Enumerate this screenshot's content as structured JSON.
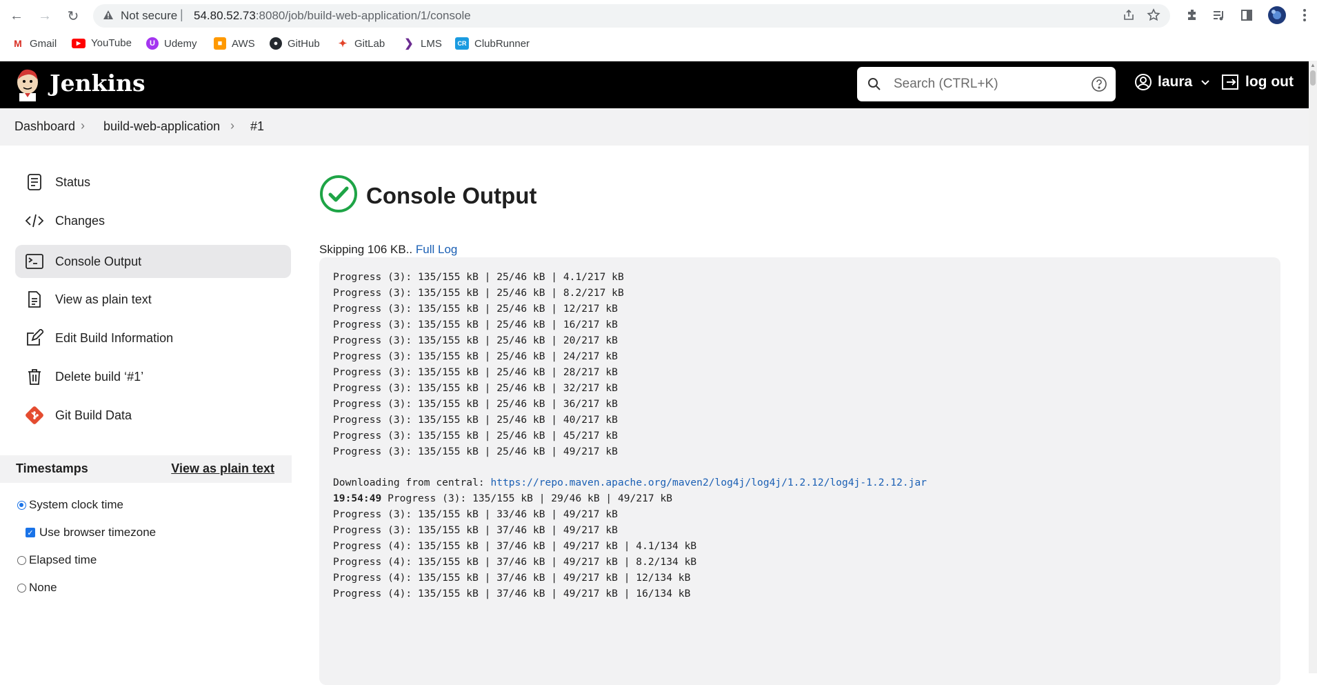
{
  "browser": {
    "security_label": "Not secure",
    "url_host": "54.80.52.73",
    "url_port_path": ":8080/job/build-web-application/1/console",
    "bookmarks": [
      "Gmail",
      "YouTube",
      "Udemy",
      "AWS",
      "GitHub",
      "GitLab",
      "LMS",
      "ClubRunner"
    ]
  },
  "header": {
    "title": "Jenkins",
    "search_placeholder": "Search (CTRL+K)",
    "user": "laura",
    "logout": "log out"
  },
  "breadcrumb": [
    "Dashboard",
    "build-web-application",
    "#1"
  ],
  "sidebar": {
    "tasks": [
      "Status",
      "Changes",
      "Console Output",
      "View as plain text",
      "Edit Build Information",
      "Delete build ‘#1’",
      "Git Build Data"
    ],
    "active_task": "Console Output",
    "timestamps_title": "Timestamps",
    "timestamps_link": "View as plain text",
    "options": {
      "system_clock": "System clock time",
      "browser_tz": "Use browser timezone",
      "elapsed": "Elapsed time",
      "none": "None"
    }
  },
  "main": {
    "title": "Console Output",
    "skipping": "Skipping 106 KB..",
    "full_log": "Full Log",
    "log_lines": [
      "Progress (3): 135/155 kB | 25/46 kB | 4.1/217 kB",
      "Progress (3): 135/155 kB | 25/46 kB | 8.2/217 kB",
      "Progress (3): 135/155 kB | 25/46 kB | 12/217 kB",
      "Progress (3): 135/155 kB | 25/46 kB | 16/217 kB",
      "Progress (3): 135/155 kB | 25/46 kB | 20/217 kB",
      "Progress (3): 135/155 kB | 25/46 kB | 24/217 kB",
      "Progress (3): 135/155 kB | 25/46 kB | 28/217 kB",
      "Progress (3): 135/155 kB | 25/46 kB | 32/217 kB",
      "Progress (3): 135/155 kB | 25/46 kB | 36/217 kB",
      "Progress (3): 135/155 kB | 25/46 kB | 40/217 kB",
      "Progress (3): 135/155 kB | 25/46 kB | 45/217 kB",
      "Progress (3): 135/155 kB | 25/46 kB | 49/217 kB"
    ],
    "download_prefix": "Downloading from central: ",
    "download_url": "https://repo.maven.apache.org/maven2/log4j/log4j/1.2.12/log4j-1.2.12.jar",
    "timestamp": "19:54:49",
    "timestamp_line": " Progress (3): 135/155 kB | 29/46 kB | 49/217 kB",
    "log_lines_2": [
      "Progress (3): 135/155 kB | 33/46 kB | 49/217 kB",
      "Progress (3): 135/155 kB | 37/46 kB | 49/217 kB",
      "Progress (4): 135/155 kB | 37/46 kB | 49/217 kB | 4.1/134 kB",
      "Progress (4): 135/155 kB | 37/46 kB | 49/217 kB | 8.2/134 kB",
      "Progress (4): 135/155 kB | 37/46 kB | 49/217 kB | 12/134 kB",
      "Progress (4): 135/155 kB | 37/46 kB | 49/217 kB | 16/134 kB"
    ]
  }
}
